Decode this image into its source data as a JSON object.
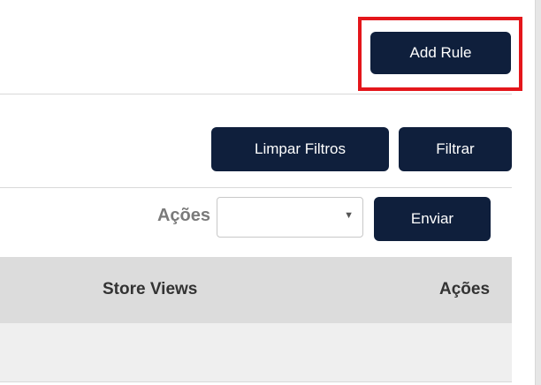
{
  "toolbar": {
    "add_rule_label": "Add Rule"
  },
  "filters": {
    "clear_label": "Limpar Filtros",
    "filter_label": "Filtrar"
  },
  "mass_actions": {
    "label": "Ações",
    "select_value": "",
    "submit_label": "Enviar"
  },
  "table": {
    "columns": [
      "Store Views",
      "Ações"
    ],
    "rows": [
      [
        "",
        ""
      ]
    ]
  },
  "icons": {
    "select_arrow": "chevron-down-icon"
  },
  "colors": {
    "button_bg": "#0f1f3c",
    "highlight": "#e4161b",
    "header_bg": "#dcdcdc",
    "row_bg": "#efefef"
  }
}
